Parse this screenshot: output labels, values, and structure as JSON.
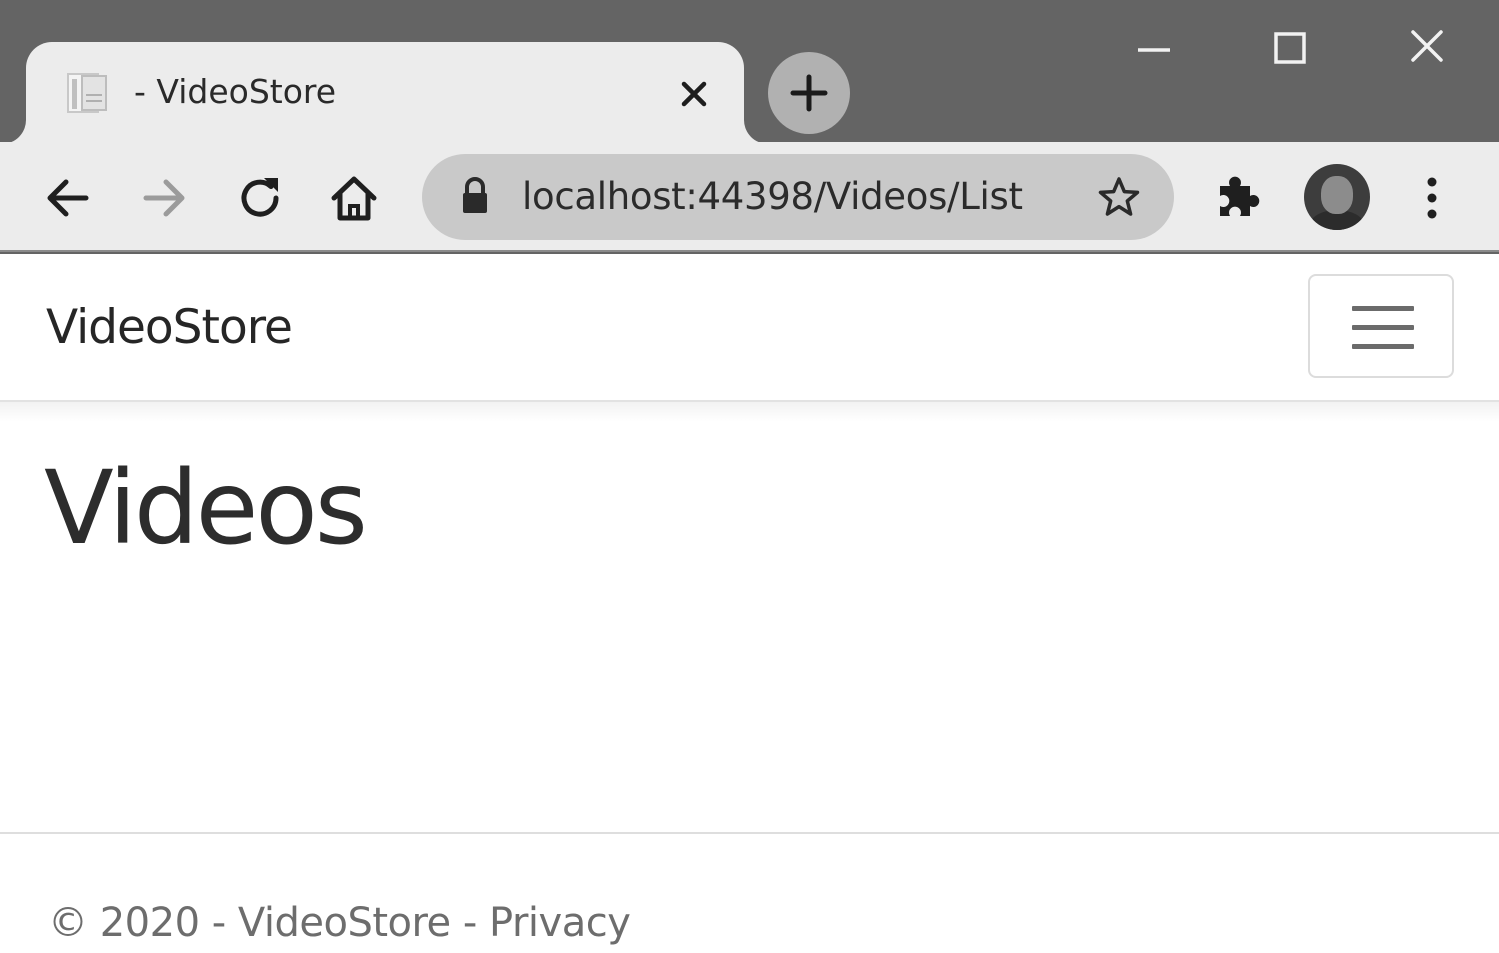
{
  "browser": {
    "tab": {
      "title": "- VideoStore",
      "favicon": "page-icon",
      "close_icon": "close-icon"
    },
    "new_tab_icon": "plus-icon",
    "window_controls": [
      "minimize-icon",
      "maximize-icon",
      "close-icon"
    ],
    "nav_icons": [
      "back-arrow-icon",
      "forward-arrow-icon",
      "reload-icon",
      "home-icon"
    ],
    "address_bar": {
      "url": "localhost:44398/Videos/List",
      "lock_icon": "lock-icon",
      "bookmark_icon": "star-icon"
    },
    "extensions_icon": "puzzle-icon",
    "menu_icon": "kebab-menu-icon",
    "colors": {
      "frame": "#646464",
      "toolbar": "#ececec",
      "omnibox": "#c9c9c9"
    }
  },
  "site": {
    "brand": "VideoStore",
    "toggler_icon": "hamburger-icon"
  },
  "main": {
    "heading": "Videos"
  },
  "footer": {
    "copyright": "© 2020 - VideoStore -",
    "privacy_link": "Privacy"
  }
}
